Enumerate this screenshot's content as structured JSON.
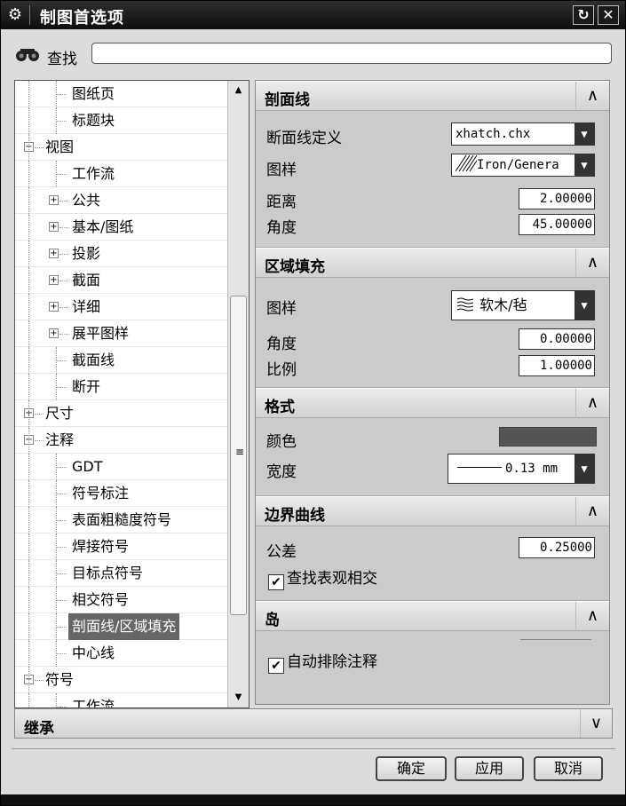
{
  "window": {
    "title": "制图首选项",
    "reset_glyph": "↻",
    "close_glyph": "✕"
  },
  "search": {
    "label": "查找",
    "value": "",
    "placeholder": ""
  },
  "tree": {
    "items": [
      {
        "label": "图纸页",
        "level": 2,
        "expander": ""
      },
      {
        "label": "标题块",
        "level": 2,
        "expander": ""
      },
      {
        "label": "视图",
        "level": 0,
        "expander": "⊟"
      },
      {
        "label": "工作流",
        "level": 2,
        "expander": ""
      },
      {
        "label": "公共",
        "level": 1,
        "expander": "⊞"
      },
      {
        "label": "基本/图纸",
        "level": 1,
        "expander": "⊞"
      },
      {
        "label": "投影",
        "level": 1,
        "expander": "⊞"
      },
      {
        "label": "截面",
        "level": 1,
        "expander": "⊞"
      },
      {
        "label": "详细",
        "level": 1,
        "expander": "⊞"
      },
      {
        "label": "展平图样",
        "level": 1,
        "expander": "⊞"
      },
      {
        "label": "截面线",
        "level": 2,
        "expander": ""
      },
      {
        "label": "断开",
        "level": 2,
        "expander": ""
      },
      {
        "label": "尺寸",
        "level": 0,
        "expander": "⊞"
      },
      {
        "label": "注释",
        "level": 0,
        "expander": "⊟"
      },
      {
        "label": "GDT",
        "level": 2,
        "expander": ""
      },
      {
        "label": "符号标注",
        "level": 2,
        "expander": ""
      },
      {
        "label": "表面粗糙度符号",
        "level": 2,
        "expander": ""
      },
      {
        "label": "焊接符号",
        "level": 2,
        "expander": ""
      },
      {
        "label": "目标点符号",
        "level": 2,
        "expander": ""
      },
      {
        "label": "相交符号",
        "level": 2,
        "expander": ""
      },
      {
        "label": "剖面线/区域填充",
        "level": 2,
        "expander": "",
        "selected": true
      },
      {
        "label": "中心线",
        "level": 2,
        "expander": ""
      },
      {
        "label": "符号",
        "level": 0,
        "expander": "⊟"
      },
      {
        "label": "工作流",
        "level": 2,
        "expander": ""
      }
    ]
  },
  "sections": {
    "hatch": {
      "title": "剖面线",
      "definition_label": "断面线定义",
      "definition_value": "xhatch.chx",
      "pattern_label": "图样",
      "pattern_value": "Iron/Genera",
      "distance_label": "距离",
      "distance_value": "2.00000",
      "angle_label": "角度",
      "angle_value": "45.00000"
    },
    "area_fill": {
      "title": "区域填充",
      "pattern_label": "图样",
      "pattern_value": "软木/毡",
      "angle_label": "角度",
      "angle_value": "0.00000",
      "scale_label": "比例",
      "scale_value": "1.00000"
    },
    "format": {
      "title": "格式",
      "color_label": "颜色",
      "color_value": "#555555",
      "width_label": "宽度",
      "width_value": "0.13 mm"
    },
    "boundary": {
      "title": "边界曲线",
      "tolerance_label": "公差",
      "tolerance_value": "0.25000",
      "find_label": "查找表观相交",
      "find_checked": true
    },
    "island": {
      "title": "岛",
      "auto_label": "自动排除注释",
      "auto_checked": true
    }
  },
  "inherit": {
    "title": "继承"
  },
  "buttons": {
    "ok": "确定",
    "apply": "应用",
    "cancel": "取消"
  }
}
